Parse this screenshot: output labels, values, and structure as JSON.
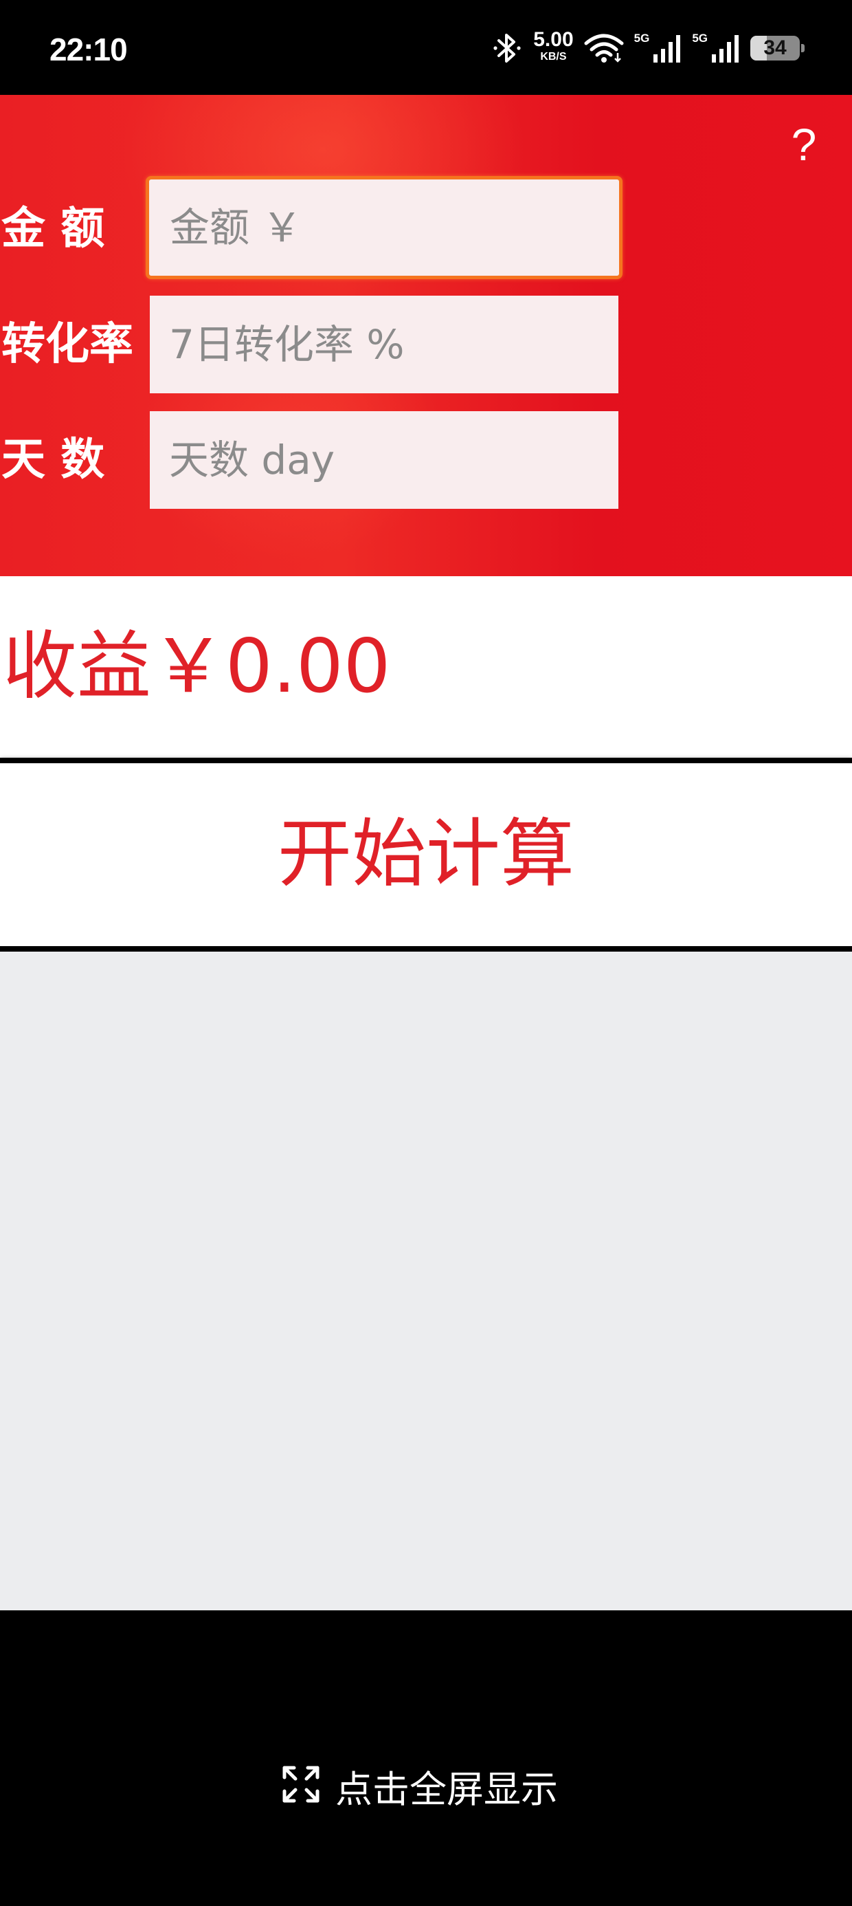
{
  "status_bar": {
    "time": "22:10",
    "net_speed_value": "5.00",
    "net_speed_unit": "KB/S",
    "sim1_label": "5G",
    "sim2_label": "5G",
    "battery_level": "34",
    "battery_fraction": 0.34,
    "icons": [
      "bluetooth-icon",
      "wifi-icon",
      "signal-icon",
      "signal-icon",
      "battery-icon"
    ]
  },
  "header": {
    "help_label": "?",
    "background_color": "#e8151f"
  },
  "form": {
    "amount": {
      "label": "金 额",
      "placeholder": "金额 ￥",
      "value": "",
      "focused": true
    },
    "rate": {
      "label": "转化率",
      "placeholder": "7日转化率 %",
      "value": ""
    },
    "days": {
      "label": "天 数",
      "placeholder": "天数 day",
      "value": ""
    }
  },
  "result": {
    "text": "收益￥0.00",
    "color": "#e02128"
  },
  "actions": {
    "start_label": "开始计算"
  },
  "footer": {
    "fullscreen_label": "点击全屏显示",
    "fullscreen_icon": "expand-icon"
  }
}
